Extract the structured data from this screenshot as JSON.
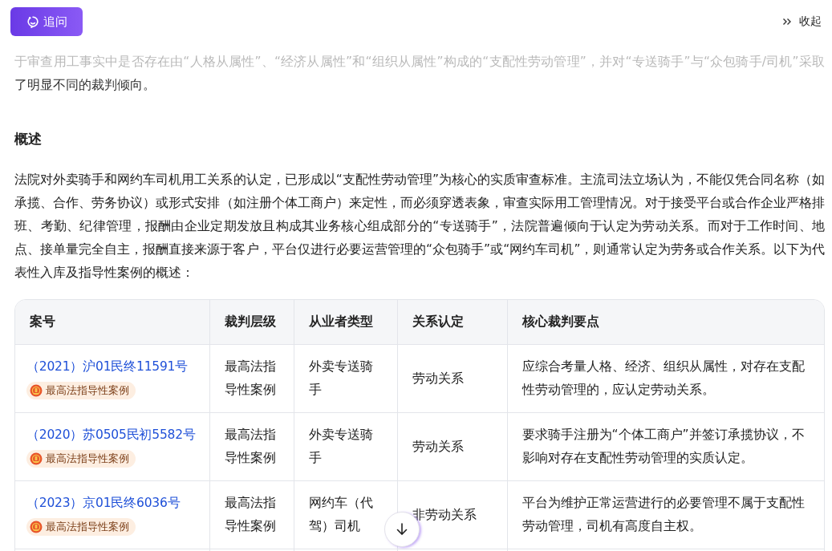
{
  "toolbar": {
    "follow_up_button": "追问",
    "collapse_button": "收起"
  },
  "intro_tail": "于审查用工事实中是否存在由“人格从属性”、“经济从属性”和“组织从属性”构成的“支配性劳动管理”，并对“专送骑手”与“众包骑手/司机”采取了明显不同的裁判倾向。",
  "section_heading": "概述",
  "summary": "法院对外卖骑手和网约车司机用工关系的认定，已形成以“支配性劳动管理”为核心的实质审查标准。主流司法立场认为，不能仅凭合同名称（如承揽、合作、劳务协议）或形式安排（如注册个体工商户）来定性，而必须穿透表象，审查实际用工管理情况。对于接受平台或合作企业严格排班、考勤、纪律管理，报酬由企业定期发放且构成其业务核心组成部分的“专送骑手”，法院普遍倾向于认定为劳动关系。而对于工作时间、地点、接单量完全自主，报酬直接来源于客户，平台仅进行必要运营管理的“众包骑手”或“网约车司机”，则通常认定为劳务或合作关系。以下为代表性入库及指导性案例的概述：",
  "table": {
    "columns": [
      "案号",
      "裁判层级",
      "从业者类型",
      "关系认定",
      "核心裁判要点"
    ],
    "rows": [
      {
        "case_no": "（2021）沪01民终11591号",
        "badge": "最高法指导性案例",
        "level": "最高法指导性案例",
        "worker_type": "外卖专送骑手",
        "relation": "劳动关系",
        "key_point": "应综合考量人格、经济、组织从属性，对存在支配性劳动管理的，应认定劳动关系。"
      },
      {
        "case_no": "（2020）苏0505民初5582号",
        "badge": "最高法指导性案例",
        "level": "最高法指导性案例",
        "worker_type": "外卖专送骑手",
        "relation": "劳动关系",
        "key_point": "要求骑手注册为“个体工商户”并签订承揽协议，不影响对存在支配性劳动管理的实质认定。"
      },
      {
        "case_no": "（2023）京01民终6036号",
        "badge": "最高法指导性案例",
        "level": "最高法指导性案例",
        "worker_type": "网约车（代驾）司机",
        "relation": "非劳动关系",
        "key_point": "平台为维护正常运营进行的必要管理不属于支配性劳动管理，司机有高度自主权。"
      }
    ]
  }
}
